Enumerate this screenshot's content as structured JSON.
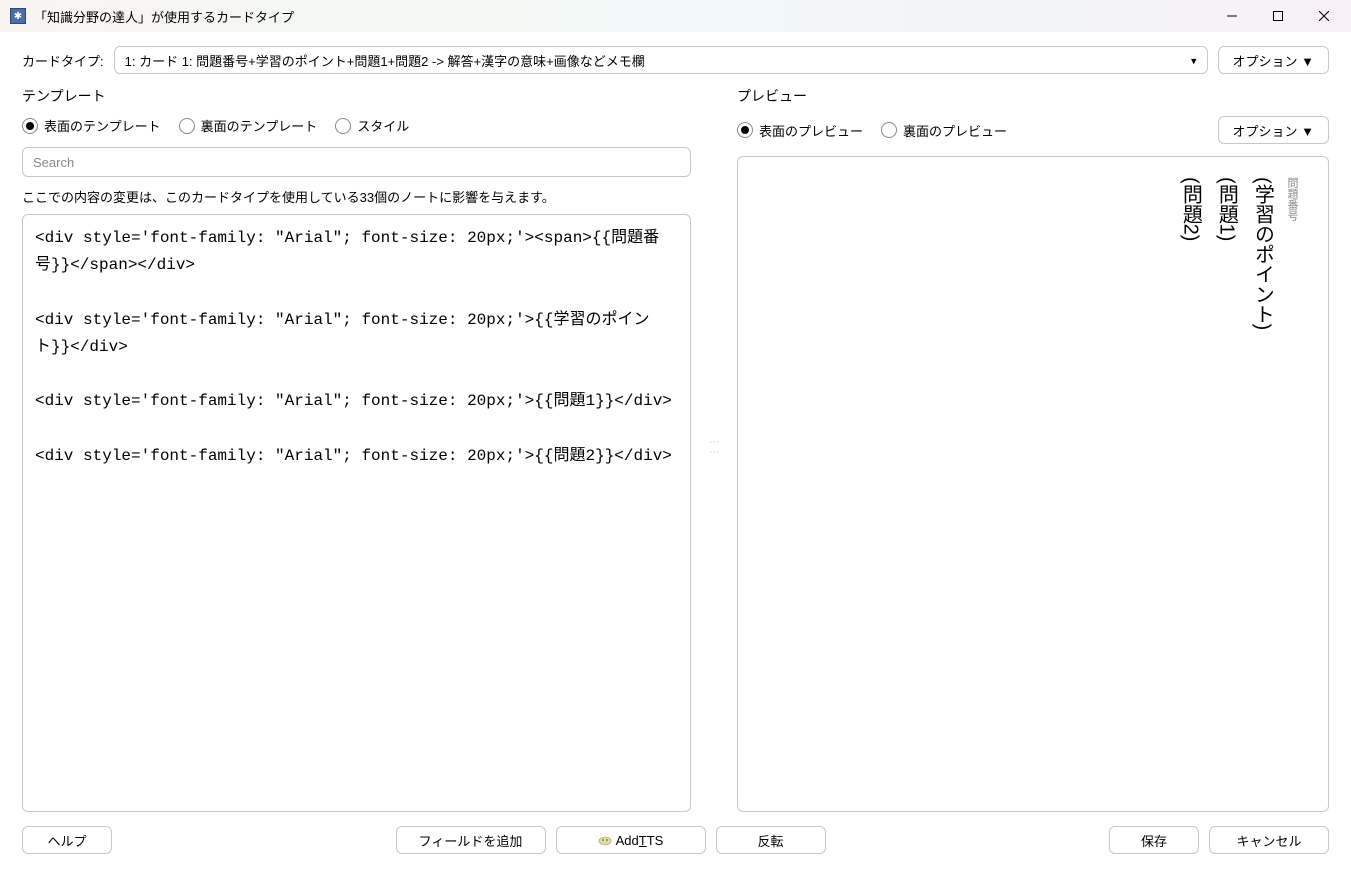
{
  "window": {
    "title": "「知識分野の達人」が使用するカードタイプ"
  },
  "toprow": {
    "label": "カードタイプ:",
    "select_value": "1: カード 1: 問題番号+学習のポイント+問題1+問題2 -> 解答+漢字の意味+画像などメモ欄",
    "options_btn": "オプション ▼"
  },
  "template": {
    "heading": "テンプレート",
    "radios": {
      "front": "表面のテンプレート",
      "back": "裏面のテンプレート",
      "style": "スタイル"
    },
    "search_placeholder": "Search",
    "notice": "ここでの内容の変更は、このカードタイプを使用している33個のノートに影響を与えます。",
    "editor_content": "<div style='font-family: \"Arial\"; font-size: 20px;'><span>{{問題番号}}</span></div>\n\n<div style='font-family: \"Arial\"; font-size: 20px;'>{{学習のポイント}}</div>\n\n<div style='font-family: \"Arial\"; font-size: 20px;'>{{問題1}}</div>\n\n<div style='font-family: \"Arial\"; font-size: 20px;'>{{問題2}}</div>"
  },
  "preview": {
    "heading": "プレビュー",
    "radios": {
      "front": "表面のプレビュー",
      "back": "裏面のプレビュー"
    },
    "options_btn": "オプション ▼",
    "lines": {
      "small": "問題番号",
      "l1": "(学習のポイント)",
      "l2": "(問題1)",
      "l3": "(問題2)"
    }
  },
  "footer": {
    "help": "ヘルプ",
    "add_field": "フィールドを追加",
    "add_tts": "Add ",
    "add_tts_u": "T",
    "add_tts_tail": "TS",
    "flip": "反転",
    "save": "保存",
    "cancel": "キャンセル"
  }
}
